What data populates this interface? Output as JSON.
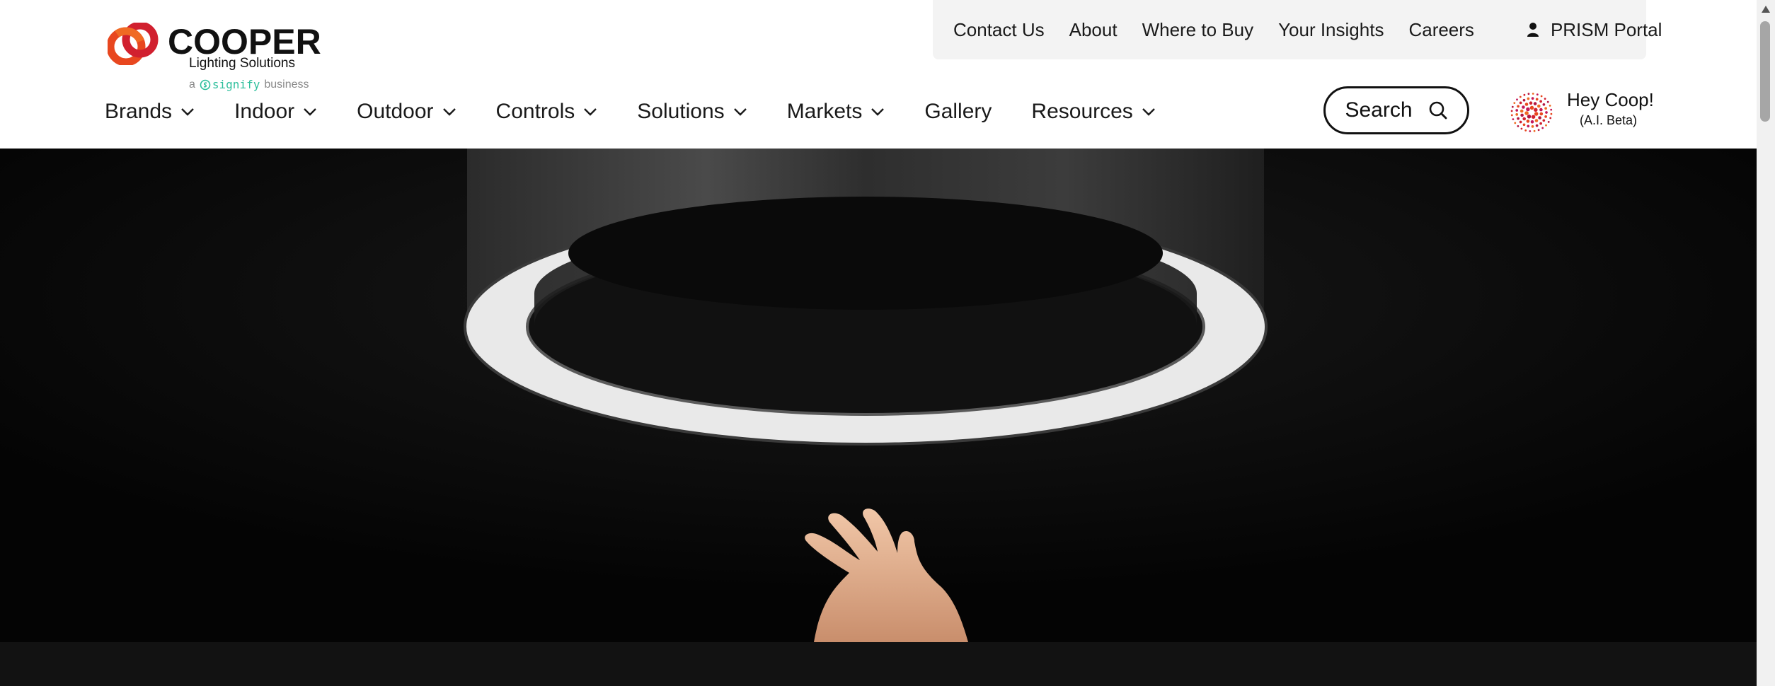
{
  "brand": {
    "name": "COOPER",
    "tagline": "Lighting Solutions",
    "parent_prefix": "a",
    "parent_name": "signify",
    "parent_suffix": "business",
    "accent_color": "#e8471f"
  },
  "utility_nav": {
    "links": [
      "Contact Us",
      "About",
      "Where to Buy",
      "Your Insights",
      "Careers"
    ],
    "portal_label": "PRISM Portal",
    "portal_icon": "user-icon"
  },
  "main_nav": {
    "items": [
      {
        "label": "Brands",
        "has_dropdown": true
      },
      {
        "label": "Indoor",
        "has_dropdown": true
      },
      {
        "label": "Outdoor",
        "has_dropdown": true
      },
      {
        "label": "Controls",
        "has_dropdown": true
      },
      {
        "label": "Solutions",
        "has_dropdown": true
      },
      {
        "label": "Markets",
        "has_dropdown": true
      },
      {
        "label": "Gallery",
        "has_dropdown": false
      },
      {
        "label": "Resources",
        "has_dropdown": true
      }
    ]
  },
  "search": {
    "label": "Search",
    "icon": "search-icon"
  },
  "assistant": {
    "title": "Hey Coop!",
    "subtitle": "(A.I. Beta)",
    "icon": "coop-dots-icon"
  },
  "hero": {
    "image": "ring-pendant-light-with-hand",
    "background": "#050505"
  }
}
